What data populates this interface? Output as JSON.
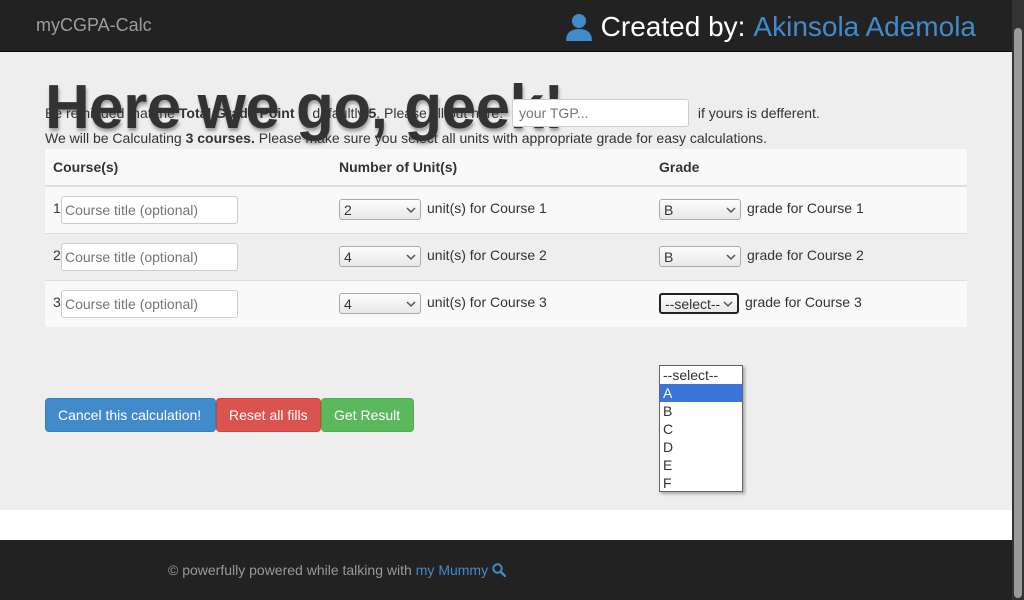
{
  "navbar": {
    "brand": "myCGPA-Calc",
    "created_by_label": "Created by:",
    "author": "Akinsola Ademola"
  },
  "headline": "Here we go, geek!",
  "intro": {
    "part1": "Be reminded that the ",
    "tgp_bold": "Total Grade Point",
    "part2": " is defaultly ",
    "tgp_default": "5",
    "part3": ". Please fill out here: ",
    "tgp_placeholder": "your TGP...",
    "part4": " if yours is defferent."
  },
  "info": {
    "part1": "We will be Calculating ",
    "courses_bold": "3 courses.",
    "part2": " Please make sure you select all units with appropriate grade for easy calculations."
  },
  "table": {
    "headers": [
      "Course(s)",
      "Number of Unit(s)",
      "Grade"
    ],
    "title_placeholder": "Course title (optional)",
    "rows": [
      {
        "num": "1",
        "units": "2",
        "units_text": "unit(s) for Course 1",
        "grade": "B",
        "grade_text": "grade for Course 1"
      },
      {
        "num": "2",
        "units": "4",
        "units_text": "unit(s) for Course 2",
        "grade": "B",
        "grade_text": "grade for Course 2"
      },
      {
        "num": "3",
        "units": "4",
        "units_text": "unit(s) for Course 3",
        "grade": "--select--",
        "grade_text": "grade for Course 3"
      }
    ]
  },
  "grade_dropdown": {
    "options": [
      "--select--",
      "A",
      "B",
      "C",
      "D",
      "E",
      "F"
    ],
    "highlighted": "A"
  },
  "buttons": {
    "cancel": "Cancel this calculation!",
    "reset": "Reset all fills",
    "result": "Get Result"
  },
  "footer": {
    "text": "© powerfully powered while talking with",
    "link": "my Mummy"
  },
  "colors": {
    "primary": "#428bca",
    "danger": "#d9534f",
    "success": "#5cb85c",
    "navbar": "#222222"
  }
}
